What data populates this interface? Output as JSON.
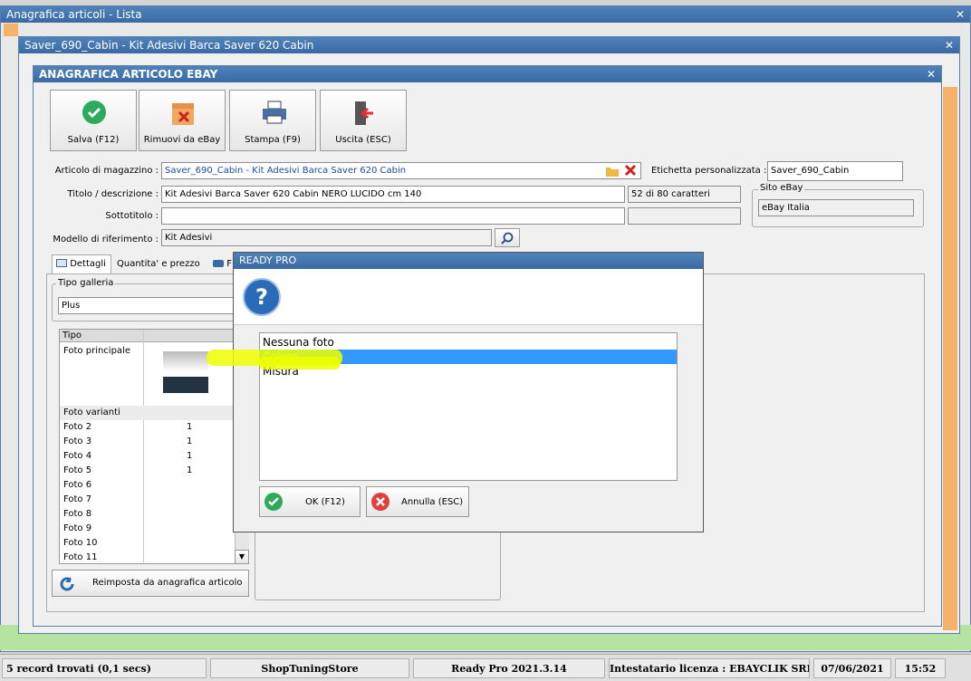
{
  "outer_window": {
    "title": "Anagrafica articoli  - Lista"
  },
  "kit_window": {
    "title": "Saver_690_Cabin - Kit  Adesivi Barca Saver 620 Cabin"
  },
  "ebay_window": {
    "title": "ANAGRAFICA ARTICOLO EBAY",
    "toolbar": {
      "save": "Salva (F12)",
      "remove": "Rimuovi da eBay",
      "print": "Stampa (F9)",
      "exit": "Uscita (ESC)"
    },
    "form": {
      "articolo_label": "Articolo di magazzino :",
      "articolo_value": "Saver_690_Cabin - Kit  Adesivi Barca Saver 620 Cabin",
      "etichetta_label": "Etichetta personalizzata :",
      "etichetta_value": "Saver_690_Cabin",
      "titolo_label": "Titolo / descrizione :",
      "titolo_value": "Kit Adesivi Barca Saver 620 Cabin NERO LUCIDO cm 140",
      "chars_count": "52 di 80 caratteri",
      "sito_label": "Sito eBay",
      "sito_value": "eBay Italia",
      "sottotitolo_label": "Sottotitolo :",
      "sottotitolo_value": "",
      "modello_label": "Modello di riferimento :",
      "modello_value": "Kit Adesivi"
    },
    "tabs": {
      "dettagli": "Dettagli",
      "quantita": "Quantita' e prezzo",
      "foto_partial": "F"
    },
    "galleria": {
      "legend": "Tipo galleria",
      "value": "Plus"
    },
    "grid": {
      "header": "Tipo",
      "principale": "Foto principale",
      "varianti": "Foto varianti",
      "rows": [
        {
          "name": "Foto 2",
          "val": "1"
        },
        {
          "name": "Foto 3",
          "val": "1"
        },
        {
          "name": "Foto 4",
          "val": "1"
        },
        {
          "name": "Foto 5",
          "val": "1"
        },
        {
          "name": "Foto 6",
          "val": ""
        },
        {
          "name": "Foto 7",
          "val": ""
        },
        {
          "name": "Foto 8",
          "val": ""
        },
        {
          "name": "Foto 9",
          "val": ""
        },
        {
          "name": "Foto 10",
          "val": ""
        },
        {
          "name": "Foto 11",
          "val": ""
        }
      ]
    },
    "reset_button": "Reimposta da anagrafica articolo"
  },
  "dialog": {
    "title": "READY PRO",
    "options": [
      "Nessuna foto",
      "Colore",
      "Misura"
    ],
    "selected": "Colore",
    "ok": "OK (F12)",
    "cancel": "Annulla (ESC)"
  },
  "statusbar": {
    "records": "5 record trovati (0,1 secs)",
    "shop": "ShopTuningStore",
    "version": "Ready Pro 2021.3.14",
    "license": "Intestatario licenza : EBAYCLIK SRLS",
    "date": "07/06/2021",
    "time": "15:52"
  },
  "colors": {
    "titlebar": "#3a6aa3",
    "selection": "#3399ff",
    "selection_text": "#ffff66",
    "highlight": "#eeff00",
    "ok_green": "#2eaa5c",
    "cancel_red": "#e04040",
    "side_orange": "#f6b26b",
    "side_green": "#b6e3a2"
  }
}
